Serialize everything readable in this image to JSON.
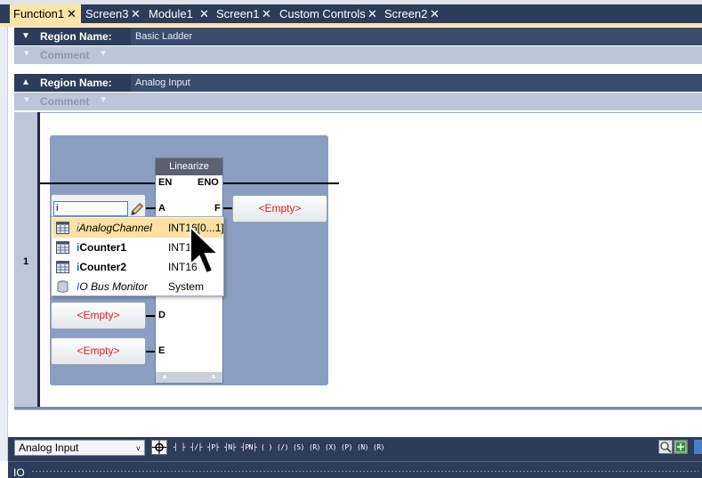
{
  "tabs": [
    {
      "label": "Function1",
      "active": true
    },
    {
      "label": "Screen3",
      "active": false
    },
    {
      "label": "Module1",
      "active": false
    },
    {
      "label": "Screen1",
      "active": false
    },
    {
      "label": "Custom Controls",
      "active": false
    },
    {
      "label": "Screen2",
      "active": false
    }
  ],
  "close_glyph": "✕",
  "regions": [
    {
      "name_label": "Region Name:",
      "name_value": "Basic Ladder",
      "comment_label": "Comment",
      "collapsed": true
    },
    {
      "name_label": "Region Name:",
      "name_value": "Analog Input",
      "comment_label": "Comment",
      "collapsed": false
    }
  ],
  "rung": {
    "number": "1"
  },
  "function_block": {
    "title": "Linearize",
    "pins": {
      "en": "EN",
      "eno": "ENO",
      "a": "A",
      "d": "D",
      "e": "E",
      "f": "F"
    }
  },
  "inputs": {
    "a_current_value": "i",
    "d_value": "<Empty>",
    "e_value": "<Empty>"
  },
  "outputs": {
    "f_value": "<Empty>"
  },
  "autocomplete": {
    "items": [
      {
        "prefix": "i",
        "name": "AnalogChannel",
        "type": "INT16[0...1]",
        "selected": true,
        "italic": true,
        "icon": "tag-table-icon"
      },
      {
        "prefix": "i",
        "name": "Counter1",
        "type": "INT16",
        "selected": false,
        "italic": false,
        "icon": "tag-table-icon"
      },
      {
        "prefix": "i",
        "name": "Counter2",
        "type": "INT16",
        "selected": false,
        "italic": false,
        "icon": "tag-table-icon"
      },
      {
        "prefix": "I",
        "name": "O Bus Monitor",
        "type": "System",
        "selected": false,
        "italic": true,
        "icon": "database-icon"
      }
    ]
  },
  "toolbar": {
    "region_select": "Analog Input",
    "instruction_symbols": [
      "┤ ├",
      "┤/├",
      "┤P├",
      "┤N├",
      "┤PN├",
      "( )",
      "(/)",
      "(S)",
      "(R)",
      "(X)",
      "(P)",
      "(N)",
      "(R)"
    ]
  },
  "status": {
    "label": "IO"
  },
  "colors": {
    "accent_tab": "#fce4a8",
    "header_dark": "#2d3c59",
    "empty_text": "#e02020",
    "selection": "#fde1a2"
  }
}
